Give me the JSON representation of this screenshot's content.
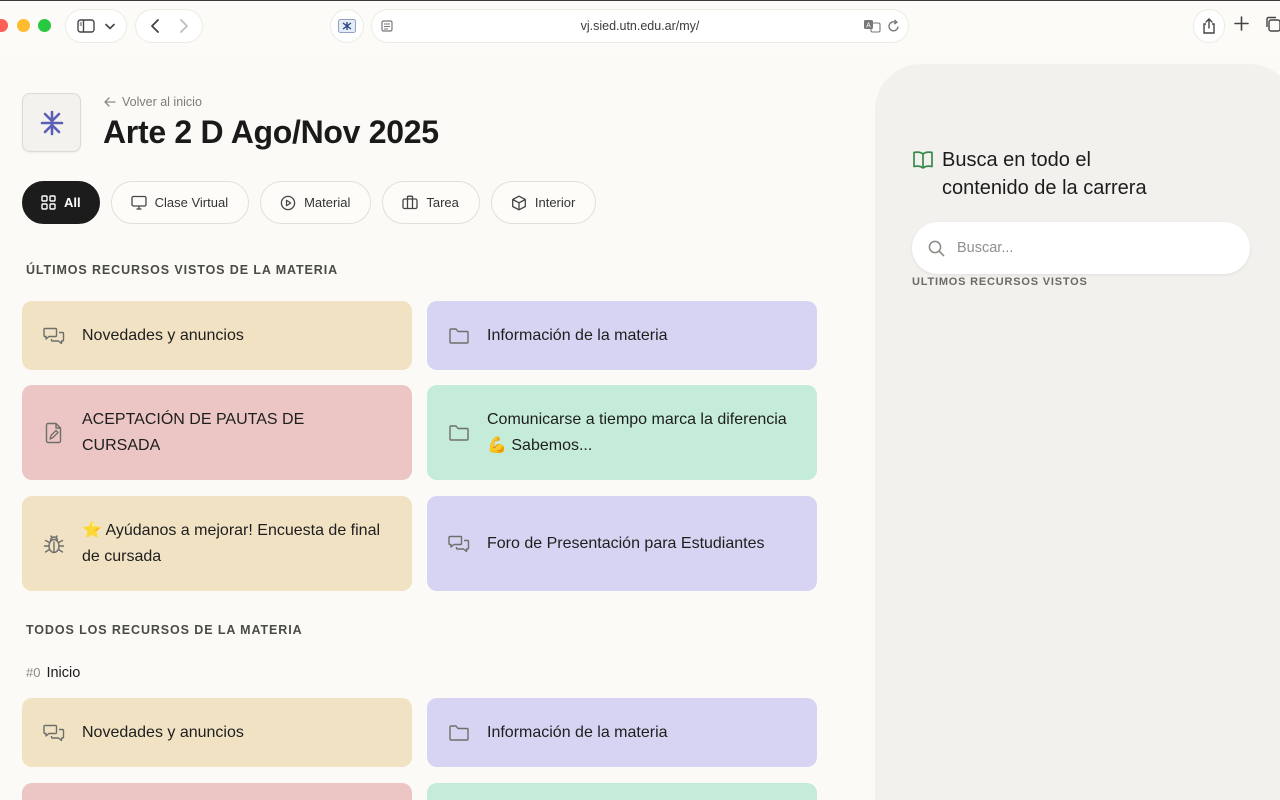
{
  "browser": {
    "url": "vj.sied.utn.edu.ar/my/"
  },
  "header": {
    "back_label": "Volver al inicio",
    "title": "Arte 2 D Ago/Nov 2025"
  },
  "filters": [
    {
      "label": "All",
      "icon": "grid-icon",
      "active": true
    },
    {
      "label": "Clase Virtual",
      "icon": "monitor-icon"
    },
    {
      "label": "Material",
      "icon": "play-circle-icon"
    },
    {
      "label": "Tarea",
      "icon": "briefcase-icon"
    },
    {
      "label": "Interior",
      "icon": "box-icon"
    }
  ],
  "recent": {
    "label": "ÚLTIMOS RECURSOS VISTOS DE LA MATERIA",
    "cards": [
      {
        "title": "Novedades y anuncios",
        "icon": "chat-icon",
        "color": "#f1e2c4"
      },
      {
        "title": "Información de la materia",
        "icon": "folder-icon",
        "color": "#d6d4f2"
      },
      {
        "title": "ACEPTACIÓN DE PAUTAS DE CURSADA",
        "icon": "document-pen-icon",
        "color": "#ebc6c4"
      },
      {
        "title": "Comunicarse a tiempo marca la diferencia 💪 Sabemos...",
        "icon": "folder-icon",
        "color": "#c4ecd8"
      },
      {
        "title": "⭐ Ayúdanos a mejorar! Encuesta de final de cursada",
        "icon": "bug-icon",
        "color": "#f1e2c4"
      },
      {
        "title": "Foro de Presentación para Estudiantes",
        "icon": "chat-icon",
        "color": "#d6d4f2"
      }
    ]
  },
  "all": {
    "label": "TODOS LOS RECURSOS DE LA MATERIA",
    "section_num": "#0",
    "section_name": "Inicio",
    "cards": [
      {
        "title": "Novedades y anuncios",
        "icon": "chat-icon",
        "color": "#f1e2c4"
      },
      {
        "title": "Información de la materia",
        "icon": "folder-icon",
        "color": "#d6d4f2"
      }
    ]
  },
  "sidepanel": {
    "title": "Busca en todo el contenido de la carrera",
    "search_placeholder": "Buscar...",
    "recent_label": "ULTIMOS RECURSOS VISTOS"
  },
  "colors": {
    "accent_green": "#3a8a4a",
    "dark": "#1c1c1c"
  }
}
